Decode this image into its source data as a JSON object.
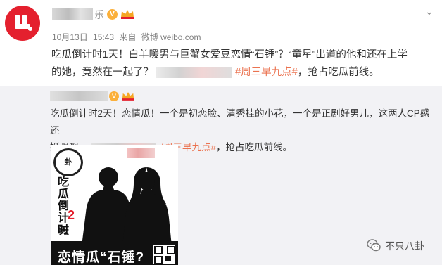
{
  "post": {
    "username_suffix": "乐",
    "verified_badge": "V",
    "date": "10月13日",
    "time": "15:43",
    "source_label": "来自",
    "source": "微博 weibo.com",
    "text_part1": "吃瓜倒计时1天！白羊暖男与巨蟹女爱豆恋情“石锤”？“童星”出道的他和还在上学",
    "text_part2": "的她，竟然在一起了？",
    "topic": "#周三早九点#",
    "text_part3": "，抢占吃瓜前线。"
  },
  "repost": {
    "verified_badge": "V",
    "text_line1": "吃瓜倒计时2天！恋情瓜！一个是初恋脸、清秀挂的小花，一个是正剧好男儿，这两人CP感还",
    "text_line2_pre": "挺强啊。",
    "topic": "#周三早九点#",
    "text_line2_post": "，抢占吃瓜前线。"
  },
  "image": {
    "vertical_text": "吃瓜倒计时",
    "count": "2",
    "unit": "天",
    "banner": "恋情瓜“石锤?"
  },
  "watermark": {
    "icon": "wechat-icon",
    "text": "不只八卦"
  },
  "colors": {
    "topic": "#eb7350",
    "brand_red": "#e4202e",
    "badge": "#fbb03b",
    "repost_bg": "#f2f2f5"
  }
}
